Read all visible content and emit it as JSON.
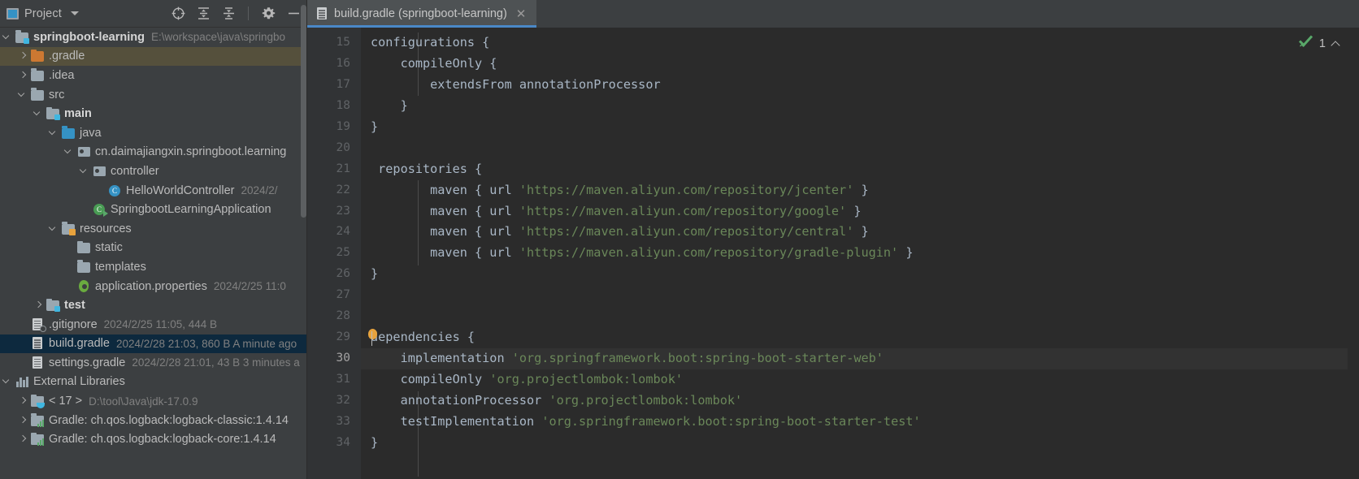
{
  "project_panel": {
    "title": "Project",
    "window_icon": "project-window-icon",
    "dropdown_icon": "chevron-down-icon",
    "toolbar": [
      {
        "name": "select-opened-file-icon",
        "glyph": "target-icon"
      },
      {
        "name": "expand-all-icon",
        "glyph": "expand-all-icon"
      },
      {
        "name": "collapse-all-icon",
        "glyph": "collapse-all-icon"
      },
      {
        "name": "settings-icon",
        "glyph": "gear-icon"
      },
      {
        "name": "hide-panel-icon",
        "glyph": "minimize-icon"
      }
    ],
    "tree": [
      {
        "label": "springboot-learning",
        "meta": "E:\\workspace\\java\\springbo",
        "indent": 0,
        "arrow": "down",
        "icon": "module-folder",
        "bold": true,
        "state": "normal"
      },
      {
        "label": ".gradle",
        "meta": "",
        "indent": 1,
        "arrow": "right",
        "icon": "folder-orange",
        "bold": false,
        "state": "hover"
      },
      {
        "label": ".idea",
        "meta": "",
        "indent": 1,
        "arrow": "right",
        "icon": "folder-grey",
        "bold": false,
        "state": "normal"
      },
      {
        "label": "src",
        "meta": "",
        "indent": 1,
        "arrow": "down",
        "icon": "folder-grey",
        "bold": false,
        "state": "normal"
      },
      {
        "label": "main",
        "meta": "",
        "indent": 2,
        "arrow": "down",
        "icon": "module-folder",
        "bold": true,
        "state": "normal"
      },
      {
        "label": "java",
        "meta": "",
        "indent": 3,
        "arrow": "down",
        "icon": "folder-blue",
        "bold": false,
        "state": "normal"
      },
      {
        "label": "cn.daimajiangxin.springboot.learning",
        "meta": "",
        "indent": 4,
        "arrow": "down",
        "icon": "package",
        "bold": false,
        "state": "normal"
      },
      {
        "label": "controller",
        "meta": "",
        "indent": 5,
        "arrow": "down",
        "icon": "package",
        "bold": false,
        "state": "normal"
      },
      {
        "label": "HelloWorldController",
        "meta": "2024/2/",
        "indent": 6,
        "arrow": "none",
        "icon": "class",
        "bold": false,
        "state": "normal"
      },
      {
        "label": "SpringbootLearningApplication",
        "meta": "",
        "indent": 5,
        "arrow": "none",
        "icon": "class-runnable",
        "bold": false,
        "state": "normal"
      },
      {
        "label": "resources",
        "meta": "",
        "indent": 3,
        "arrow": "down",
        "icon": "resources-folder",
        "bold": false,
        "state": "normal"
      },
      {
        "label": "static",
        "meta": "",
        "indent": 4,
        "arrow": "none",
        "icon": "folder-grey",
        "bold": false,
        "state": "normal"
      },
      {
        "label": "templates",
        "meta": "",
        "indent": 4,
        "arrow": "none",
        "icon": "folder-grey",
        "bold": false,
        "state": "normal"
      },
      {
        "label": "application.properties",
        "meta": "2024/2/25 11:0",
        "indent": 4,
        "arrow": "none",
        "icon": "properties-file",
        "bold": false,
        "state": "normal"
      },
      {
        "label": "test",
        "meta": "",
        "indent": 2,
        "arrow": "right",
        "icon": "module-folder",
        "bold": true,
        "state": "normal"
      },
      {
        "label": ".gitignore",
        "meta": "2024/2/25 11:05, 444 B",
        "indent": 1,
        "arrow": "none",
        "icon": "ignored-file",
        "bold": false,
        "state": "normal"
      },
      {
        "label": "build.gradle",
        "meta": "2024/2/28 21:03, 860 B A minute ago",
        "indent": 1,
        "arrow": "none",
        "icon": "gradle-file",
        "bold": false,
        "state": "selected"
      },
      {
        "label": "settings.gradle",
        "meta": "2024/2/28 21:01, 43 B 3 minutes a",
        "indent": 1,
        "arrow": "none",
        "icon": "gradle-file",
        "bold": false,
        "state": "normal"
      },
      {
        "label": "External Libraries",
        "meta": "",
        "indent": 0,
        "arrow": "down",
        "icon": "library",
        "bold": false,
        "state": "normal"
      },
      {
        "label": "< 17 >",
        "meta": "D:\\tool\\Java\\jdk-17.0.9",
        "indent": 1,
        "arrow": "right",
        "icon": "jdk",
        "bold": false,
        "state": "normal"
      },
      {
        "label": "Gradle: ch.qos.logback:logback-classic:1.4.14",
        "meta": "",
        "indent": 1,
        "arrow": "right",
        "icon": "jar",
        "bold": false,
        "state": "normal"
      },
      {
        "label": "Gradle: ch.qos.logback:logback-core:1.4.14",
        "meta": "",
        "indent": 1,
        "arrow": "right",
        "icon": "jar",
        "bold": false,
        "state": "normal"
      }
    ]
  },
  "editor": {
    "tab": {
      "label": "build.gradle (springboot-learning)",
      "file_icon": "gradle-file-icon",
      "close_icon": "close-icon"
    },
    "inspection": {
      "check_icon": "green-check-icon",
      "count": "1",
      "chevron_icon": "chevron-up-icon"
    },
    "first_line_number": 15,
    "current_line": 30,
    "lines": [
      {
        "n": 15,
        "tokens": [
          {
            "t": "configurations {",
            "c": "def"
          }
        ]
      },
      {
        "n": 16,
        "tokens": [
          {
            "t": "    compileOnly {",
            "c": "def"
          }
        ]
      },
      {
        "n": 17,
        "tokens": [
          {
            "t": "        extendsFrom annotationProcessor",
            "c": "def"
          }
        ]
      },
      {
        "n": 18,
        "tokens": [
          {
            "t": "    }",
            "c": "def"
          }
        ]
      },
      {
        "n": 19,
        "tokens": [
          {
            "t": "}",
            "c": "def"
          }
        ]
      },
      {
        "n": 20,
        "tokens": [
          {
            "t": "",
            "c": "def"
          }
        ]
      },
      {
        "n": 21,
        "tokens": [
          {
            "t": " repositories {",
            "c": "def"
          }
        ]
      },
      {
        "n": 22,
        "tokens": [
          {
            "t": "        maven { url ",
            "c": "def"
          },
          {
            "t": "'https://maven.aliyun.com/repository/jcenter'",
            "c": "str"
          },
          {
            "t": " }",
            "c": "def"
          }
        ]
      },
      {
        "n": 23,
        "tokens": [
          {
            "t": "        maven { url ",
            "c": "def"
          },
          {
            "t": "'https://maven.aliyun.com/repository/google'",
            "c": "str"
          },
          {
            "t": " }",
            "c": "def"
          }
        ]
      },
      {
        "n": 24,
        "tokens": [
          {
            "t": "        maven { url ",
            "c": "def"
          },
          {
            "t": "'https://maven.aliyun.com/repository/central'",
            "c": "str"
          },
          {
            "t": " }",
            "c": "def"
          }
        ]
      },
      {
        "n": 25,
        "tokens": [
          {
            "t": "        maven { url ",
            "c": "def"
          },
          {
            "t": "'https://maven.aliyun.com/repository/gradle-plugin'",
            "c": "str"
          },
          {
            "t": " }",
            "c": "def"
          }
        ]
      },
      {
        "n": 26,
        "tokens": [
          {
            "t": "}",
            "c": "def"
          }
        ]
      },
      {
        "n": 27,
        "tokens": [
          {
            "t": "",
            "c": "def"
          }
        ]
      },
      {
        "n": 28,
        "tokens": [
          {
            "t": "",
            "c": "def"
          }
        ]
      },
      {
        "n": 29,
        "tokens": [
          {
            "t": "dependencies {",
            "c": "def"
          }
        ]
      },
      {
        "n": 30,
        "tokens": [
          {
            "t": "    implementation ",
            "c": "def"
          },
          {
            "t": "'org.springframework.boot:spring-boot-starter-web'",
            "c": "str"
          }
        ]
      },
      {
        "n": 31,
        "tokens": [
          {
            "t": "    compileOnly ",
            "c": "def"
          },
          {
            "t": "'org.projectlombok:lombok'",
            "c": "str"
          }
        ]
      },
      {
        "n": 32,
        "tokens": [
          {
            "t": "    annotationProcessor ",
            "c": "def"
          },
          {
            "t": "'org.projectlombok:lombok'",
            "c": "str"
          }
        ]
      },
      {
        "n": 33,
        "tokens": [
          {
            "t": "    testImplementation ",
            "c": "def"
          },
          {
            "t": "'org.springframework.boot:spring-boot-starter-test'",
            "c": "str"
          }
        ]
      },
      {
        "n": 34,
        "tokens": [
          {
            "t": "}",
            "c": "def"
          }
        ]
      }
    ]
  },
  "colors": {
    "panel_bg": "#3c3f41",
    "editor_bg": "#2b2b2b",
    "gutter_bg": "#313335",
    "selection_blue": "#0d293e",
    "hover_olive": "#55503c",
    "tab_active": "#4e5254",
    "tab_underline": "#4a88c7",
    "string_green": "#6a8759",
    "code_default": "#a9b7c6",
    "check_green": "#59a869",
    "caret_orange": "#e8a33d",
    "current_line": "#323232"
  }
}
